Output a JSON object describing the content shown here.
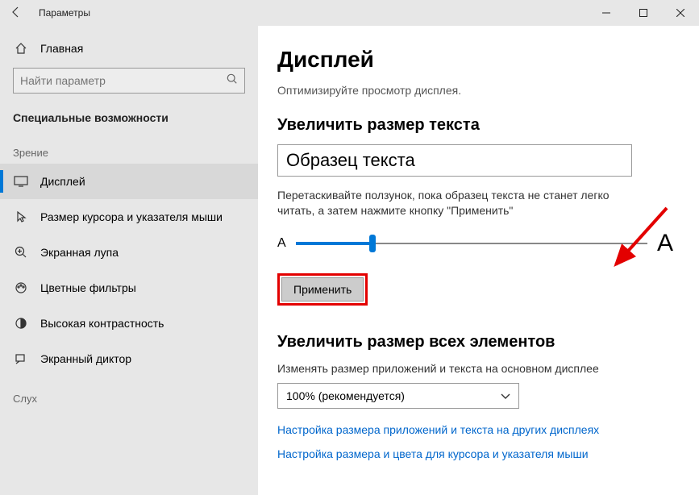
{
  "window": {
    "title": "Параметры"
  },
  "sidebar": {
    "home_label": "Главная",
    "search_placeholder": "Найти параметр",
    "section_title": "Специальные возможности",
    "group_vision": "Зрение",
    "group_hearing": "Слух",
    "items": [
      {
        "label": "Дисплей"
      },
      {
        "label": "Размер курсора и указателя мыши"
      },
      {
        "label": "Экранная лупа"
      },
      {
        "label": "Цветные фильтры"
      },
      {
        "label": "Высокая контрастность"
      },
      {
        "label": "Экранный диктор"
      }
    ]
  },
  "main": {
    "page_title": "Дисплей",
    "description": "Оптимизируйте просмотр дисплея.",
    "text_size_header": "Увеличить размер текста",
    "sample_text": "Образец текста",
    "slider_hint": "Перетаскивайте ползунок, пока образец текста не станет легко читать, а затем нажмите кнопку \"Применить\"",
    "small_a": "A",
    "big_a": "A",
    "apply_label": "Применить",
    "scale_header": "Увеличить размер всех элементов",
    "scale_desc": "Изменять размер приложений и текста на основном дисплее",
    "scale_value": "100% (рекомендуется)",
    "link1": "Настройка размера приложений и текста на других дисплеях",
    "link2": "Настройка размера и цвета для курсора и указателя мыши"
  }
}
